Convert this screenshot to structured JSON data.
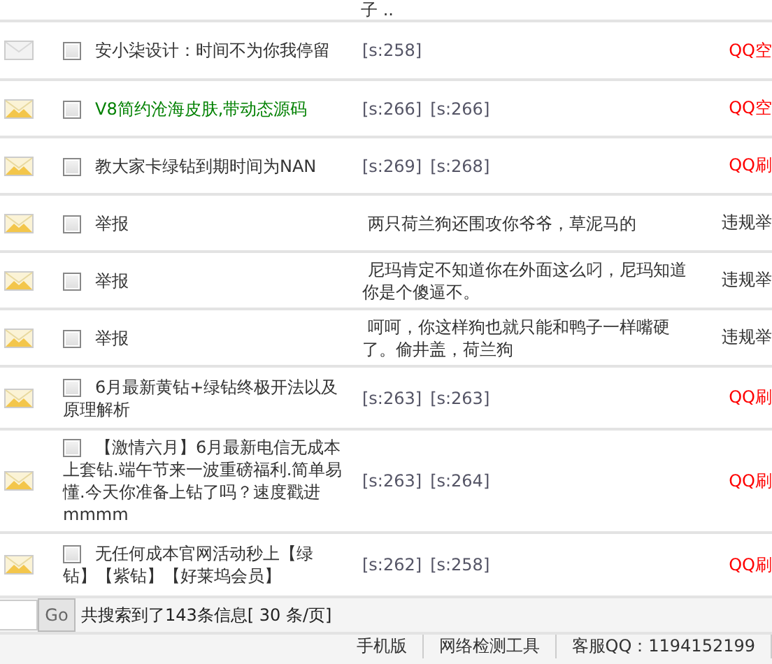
{
  "top_fragment": "子 ..",
  "rows": [
    {
      "read": true,
      "checked": false,
      "title": "安小柒设计：时间不为你我停留",
      "color": "#333333",
      "meta": {
        "kind": "tags",
        "tags": [
          "[s:258]"
        ]
      },
      "tag": {
        "text": "QQ空",
        "color": "#ff0000"
      }
    },
    {
      "read": false,
      "checked": false,
      "title": "V8简约沧海皮肤,带动态源码",
      "color": "#008000",
      "meta": {
        "kind": "tags",
        "tags": [
          "[s:266]",
          "[s:266]"
        ]
      },
      "tag": {
        "text": "QQ空",
        "color": "#ff0000"
      }
    },
    {
      "read": false,
      "checked": false,
      "title": "教大家卡绿钻到期时间为NAN",
      "color": "#333333",
      "meta": {
        "kind": "tags",
        "tags": [
          "[s:269]",
          "[s:268]"
        ]
      },
      "tag": {
        "text": "QQ刷",
        "color": "#ff0000"
      }
    },
    {
      "read": false,
      "checked": false,
      "title": "举报",
      "color": "#333333",
      "meta": {
        "kind": "text",
        "text": " 两只荷兰狗还围攻你爷爷，草泥马的"
      },
      "tag": {
        "text": "违规举",
        "color": "#333333"
      }
    },
    {
      "read": false,
      "checked": false,
      "title": "举报",
      "color": "#333333",
      "meta": {
        "kind": "text",
        "text": " 尼玛肯定不知道你在外面这么叼，尼玛知道你是个傻逼不。"
      },
      "tag": {
        "text": "违规举",
        "color": "#333333"
      }
    },
    {
      "read": false,
      "checked": false,
      "title": "举报",
      "color": "#333333",
      "meta": {
        "kind": "text",
        "text": " 呵呵，你这样狗也就只能和鸭子一样嘴硬了。偷井盖，荷兰狗"
      },
      "tag": {
        "text": "违规举",
        "color": "#333333"
      }
    },
    {
      "read": false,
      "checked": false,
      "title": "6月最新黄钻+绿钻终极开法以及原理解析",
      "color": "#333333",
      "meta": {
        "kind": "tags",
        "tags": [
          "[s:263]",
          "[s:263]"
        ]
      },
      "tag": {
        "text": "QQ刷",
        "color": "#ff0000"
      }
    },
    {
      "read": false,
      "checked": false,
      "title": "【激情六月】6月最新电信无成本上套钻.端午节来一波重磅福利.简单易懂.今天你准备上钻了吗？速度戳进mmmm",
      "color": "#333333",
      "meta": {
        "kind": "tags",
        "tags": [
          "[s:263]",
          "[s:264]"
        ]
      },
      "tag": {
        "text": "QQ刷",
        "color": "#ff0000"
      }
    },
    {
      "read": false,
      "checked": false,
      "title": "无任何成本官网活动秒上【绿钻】【紫钻】【好莱坞会员】",
      "color": "#333333",
      "meta": {
        "kind": "tags",
        "tags": [
          "[s:262]",
          "[s:258]"
        ]
      },
      "tag": {
        "text": "QQ刷",
        "color": "#ff0000"
      }
    }
  ],
  "pager": {
    "go": "Go",
    "summary": "共搜索到了143条信息[ 30 条/页]"
  },
  "footer": [
    "手机版",
    "网络检测工具",
    "客服QQ：1194152199"
  ]
}
